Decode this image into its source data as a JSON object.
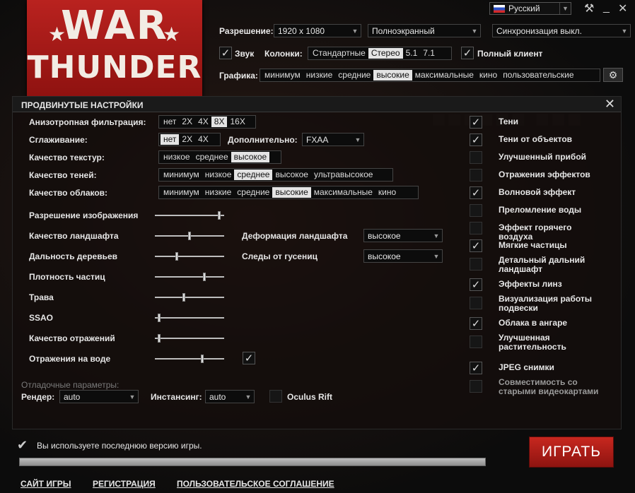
{
  "logo": {
    "line1": "WAR",
    "line2": "THUNDER"
  },
  "language": {
    "value": "Русский"
  },
  "top": {
    "resolution_label": "Разрешение:",
    "resolution_value": "1920 x 1080",
    "mode_value": "Полноэкранный",
    "vsync_value": "Синхронизация выкл.",
    "sound_label": "Звук",
    "speakers_label": "Колонки:",
    "speakers_options": [
      "Стандартные",
      "Стерео",
      "5.1",
      "7.1"
    ],
    "speakers_selected": "Стерео",
    "full_client_label": "Полный клиент",
    "graphics_label": "Графика:",
    "graphics_options": [
      "минимум",
      "низкие",
      "средние",
      "высокие",
      "максимальные",
      "кино",
      "пользовательские"
    ],
    "graphics_selected": "высокие"
  },
  "panel": {
    "title": "ПРОДВИНУТЫЕ НАСТРОЙКИ",
    "aniso_label": "Анизотропная фильтрация:",
    "aniso_options": [
      "нет",
      "2X",
      "4X",
      "8X",
      "16X"
    ],
    "aniso_selected": "8X",
    "aa_label": "Сглаживание:",
    "aa_options": [
      "нет",
      "2X",
      "4X"
    ],
    "aa_selected": "нет",
    "extra_label": "Дополнительно:",
    "extra_value": "FXAA",
    "tex_label": "Качество текстур:",
    "tex_options": [
      "низкое",
      "среднее",
      "высокое"
    ],
    "tex_selected": "высокое",
    "shadow_label": "Качество теней:",
    "shadow_options": [
      "минимум",
      "низкое",
      "среднее",
      "высокое",
      "ультравысокое"
    ],
    "shadow_selected": "среднее",
    "cloud_label": "Качество облаков:",
    "cloud_options": [
      "минимум",
      "низкие",
      "средние",
      "высокие",
      "максимальные",
      "кино"
    ],
    "cloud_selected": "высокие",
    "sliders": [
      {
        "label": "Разрешение изображения",
        "value": 0.95
      },
      {
        "label": "Качество ландшафта",
        "value": 0.5
      },
      {
        "label": "Дальность деревьев",
        "value": 0.31
      },
      {
        "label": "Плотность частиц",
        "value": 0.72
      },
      {
        "label": "Трава",
        "value": 0.42
      },
      {
        "label": "SSAO",
        "value": 0.04
      },
      {
        "label": "Качество отражений",
        "value": 0.04
      },
      {
        "label": "Отражения на воде",
        "value": 0.69
      }
    ],
    "terrain_deform_label": "Деформация ландшафта",
    "terrain_deform_value": "высокое",
    "tracks_label": "Следы от гусениц",
    "tracks_value": "высокое",
    "debug_label": "Отладочные параметры:",
    "render_label": "Рендер:",
    "render_value": "auto",
    "instancing_label": "Инстансинг:",
    "instancing_value": "auto",
    "oculus_label": "Oculus Rift",
    "right_options": [
      {
        "label": "Тени",
        "checked": true
      },
      {
        "label": "Тени от объектов",
        "checked": true
      },
      {
        "label": "Улучшенный прибой",
        "checked": false
      },
      {
        "label": "Отражения эффектов",
        "checked": false
      },
      {
        "label": "Волновой эффект",
        "checked": true
      },
      {
        "label": "Преломление воды",
        "checked": false
      },
      {
        "label": "Эффект горячего воздуха",
        "checked": false
      },
      {
        "label": "Мягкие частицы",
        "checked": true
      },
      {
        "label": "Детальный дальний ландшафт",
        "checked": false
      },
      {
        "label": "Эффекты линз",
        "checked": true
      },
      {
        "label": "Визуализация работы подвески",
        "checked": false
      },
      {
        "label": "Облака в ангаре",
        "checked": true
      },
      {
        "label": "Улучшенная растительность",
        "checked": false
      },
      {
        "label": "JPEG снимки",
        "checked": true
      },
      {
        "label": "Совместимость со старыми видеокартами",
        "checked": false
      }
    ]
  },
  "bottom": {
    "status": "Вы используете последнюю версию игры.",
    "progress": 1.0,
    "play_label": "ИГРАТЬ",
    "links": [
      "САЙТ ИГРЫ",
      "РЕГИСТРАЦИЯ",
      "ПОЛЬЗОВАТЕЛЬСКОЕ СОГЛАШЕНИЕ"
    ]
  }
}
